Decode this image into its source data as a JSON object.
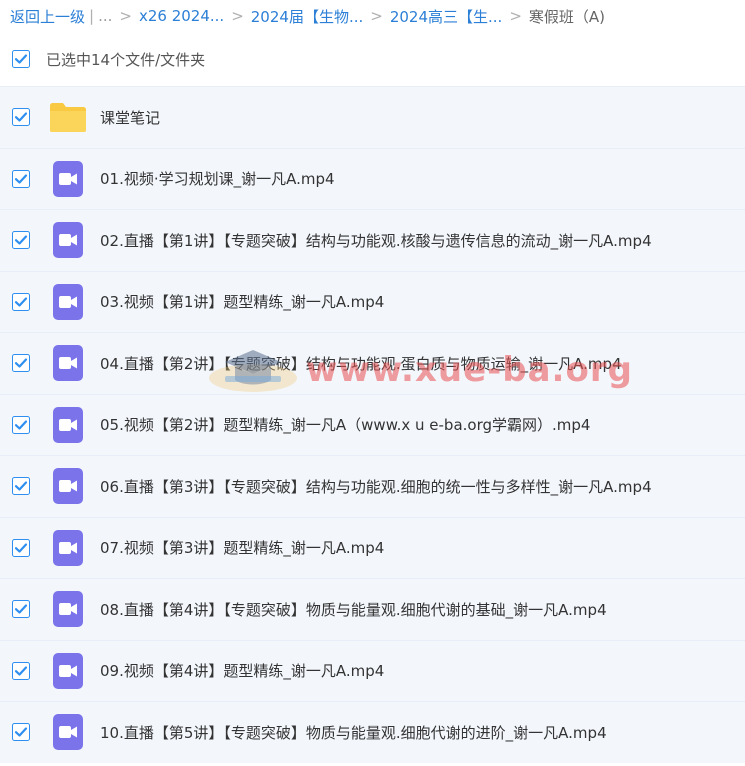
{
  "breadcrumb": {
    "back": "返回上一级",
    "pipe": "|",
    "ellipsis": "...",
    "items": [
      "x26 2024...",
      "2024届【生物...",
      "2024高三【生..."
    ],
    "current": "寒假班（A)"
  },
  "selection": {
    "label": "已选中14个文件/文件夹"
  },
  "files": [
    {
      "name": "课堂笔记",
      "type": "folder-icon"
    },
    {
      "name": "01.视频·学习规划课_谢一凡A.mp4",
      "type": "video-icon"
    },
    {
      "name": "02.直播【第1讲】【专题突破】结构与功能观.核酸与遗传信息的流动_谢一凡A.mp4",
      "type": "video-icon"
    },
    {
      "name": "03.视频【第1讲】题型精练_谢一凡A.mp4",
      "type": "video-icon"
    },
    {
      "name": "04.直播【第2讲】【专题突破】结构与功能观.蛋白质与物质运输_谢一凡A.mp4",
      "type": "video-icon"
    },
    {
      "name": "05.视频【第2讲】题型精练_谢一凡A（www.x u e-ba.org学霸网）.mp4",
      "type": "video-icon"
    },
    {
      "name": "06.直播【第3讲】【专题突破】结构与功能观.细胞的统一性与多样性_谢一凡A.mp4",
      "type": "video-icon"
    },
    {
      "name": "07.视频【第3讲】题型精练_谢一凡A.mp4",
      "type": "video-icon"
    },
    {
      "name": "08.直播【第4讲】【专题突破】物质与能量观.细胞代谢的基础_谢一凡A.mp4",
      "type": "video-icon"
    },
    {
      "name": "09.视频【第4讲】题型精练_谢一凡A.mp4",
      "type": "video-icon"
    },
    {
      "name": "10.直播【第5讲】【专题突破】物质与能量观.细胞代谢的进阶_谢一凡A.mp4",
      "type": "video-icon"
    }
  ],
  "watermark": {
    "text": "www.xue-ba.org"
  },
  "colors": {
    "link": "#2b7fd6",
    "checkbox": "#2e8ff0",
    "row_bg": "#f3f7fc",
    "folder": "#f9c941",
    "video": "#7a73ea"
  }
}
